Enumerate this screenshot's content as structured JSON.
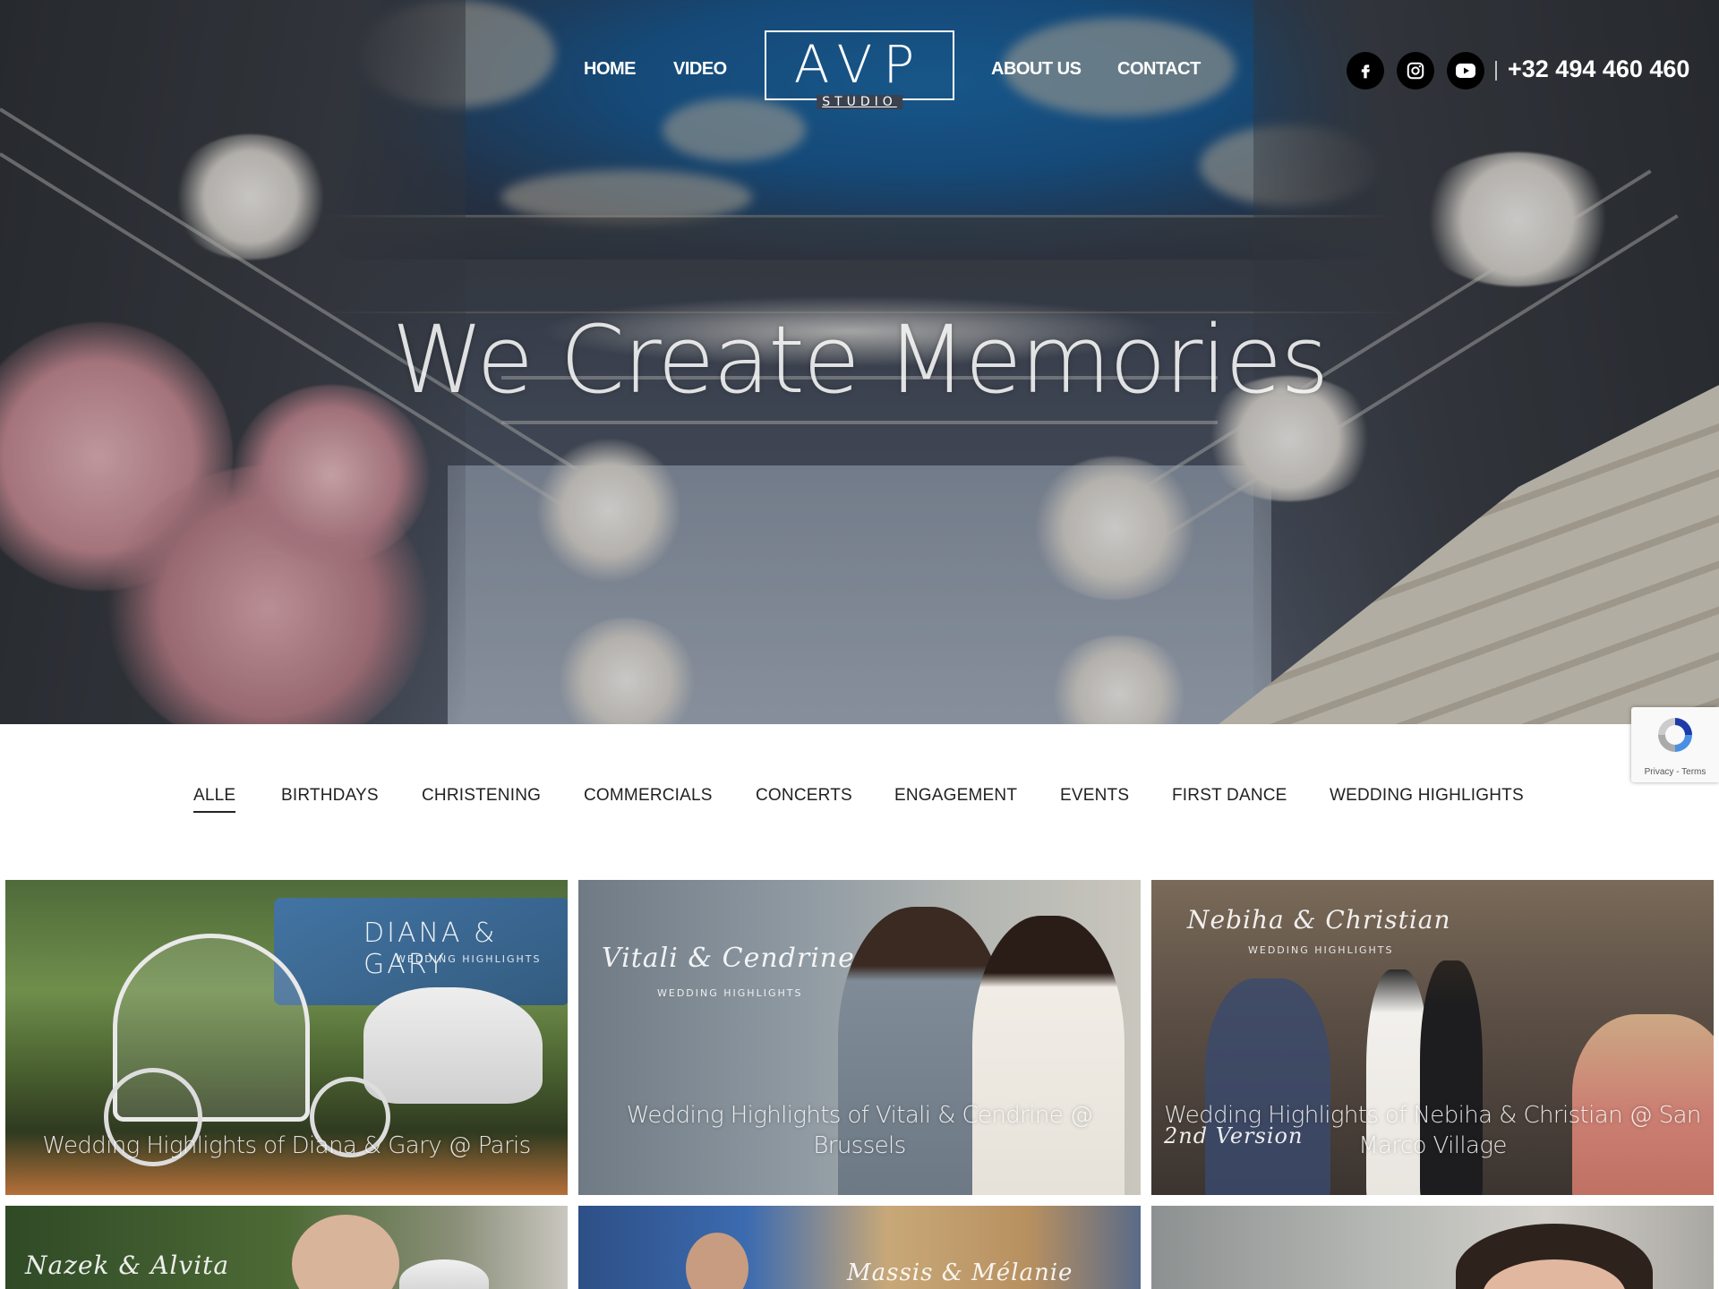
{
  "nav": {
    "home": "HOME",
    "video": "VIDEO",
    "about": "ABOUT US",
    "contact": "CONTACT",
    "logo_letters": "AVP",
    "logo_sub": "STUDIO",
    "phone": "+32 494 460 460",
    "social": [
      "facebook-icon",
      "instagram-icon",
      "youtube-icon"
    ]
  },
  "hero": {
    "title": "We Create Memories"
  },
  "recaptcha": {
    "terms": "Privacy - Terms"
  },
  "filters": [
    {
      "label": "ALLE",
      "active": true
    },
    {
      "label": "BIRTHDAYS",
      "active": false
    },
    {
      "label": "CHRISTENING",
      "active": false
    },
    {
      "label": "COMMERCIALS",
      "active": false
    },
    {
      "label": "CONCERTS",
      "active": false
    },
    {
      "label": "ENGAGEMENT",
      "active": false
    },
    {
      "label": "EVENTS",
      "active": false
    },
    {
      "label": "FIRST DANCE",
      "active": false
    },
    {
      "label": "WEDDING HIGHLIGHTS",
      "active": false
    }
  ],
  "cards": [
    {
      "overlay_name": "DIANA & GARY",
      "overlay_sub": "WEDDING HIGHLIGHTS",
      "caption": "Wedding Highlights of Diana & Gary @ Paris"
    },
    {
      "overlay_name": "Vitali & Cendrine",
      "overlay_sub": "WEDDING HIGHLIGHTS",
      "caption": "Wedding Highlights of Vitali & Cendrine @ Brussels"
    },
    {
      "overlay_name": "Nebiha & Christian",
      "overlay_sub": "WEDDING HIGHLIGHTS",
      "overlay_extra": "2nd Version",
      "caption": "Wedding Highlights of Nebiha & Christian @ San Marco Village"
    },
    {
      "overlay_name": "Nazek & Alvita",
      "overlay_sub": "",
      "caption": ""
    },
    {
      "overlay_name": "Massis & Mélanie",
      "overlay_sub": "",
      "caption": ""
    },
    {
      "overlay_name": "",
      "overlay_sub": "",
      "caption": ""
    }
  ]
}
